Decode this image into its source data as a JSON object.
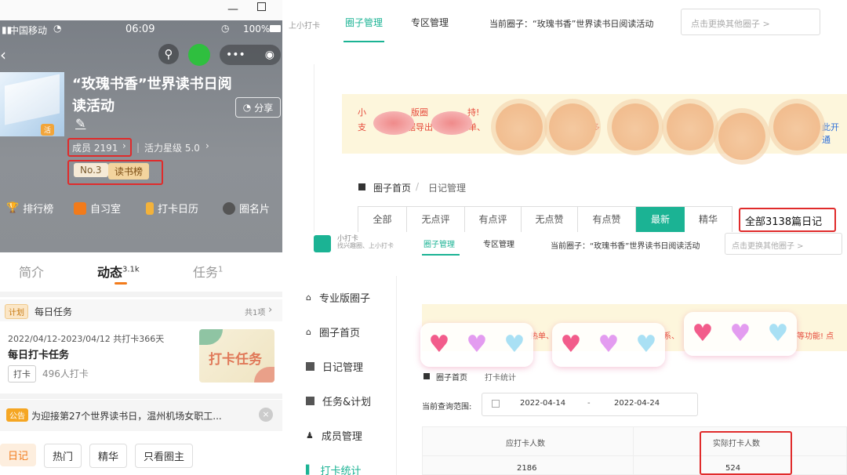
{
  "phone": {
    "status": {
      "carrier": "中国移动",
      "time": "06:09",
      "battery": "100%"
    },
    "circle_title": "“玫瑰书香”世界读书日阅读活动",
    "share_label": "分享",
    "members": "成员 2191",
    "vitality": "活力星级 5.0",
    "rank_no": "No.3",
    "rank_list": "读书榜",
    "badge": "活",
    "quick_links": [
      "排行榜",
      "自习室",
      "打卡日历",
      "圈名片"
    ],
    "tabs": [
      {
        "label": "简介",
        "sup": ""
      },
      {
        "label": "动态",
        "sup": "3.1k"
      },
      {
        "label": "任务",
        "sup": "1"
      }
    ],
    "plan_tag": "计划",
    "daily_task": "每日任务",
    "task_count": "共1项",
    "task_date": "2022/04/12-2023/04/12 共打卡366天",
    "task_name": "每日打卡任务",
    "task_btn": "打卡",
    "task_people": "496人打卡",
    "task_thumb_text": "打卡任务",
    "notice_tag": "公告",
    "notice_text": "为迎接第27个世界读书日，温州机场女职工...",
    "filters": [
      "日记",
      "热门",
      "精华",
      "只看圈主"
    ]
  },
  "top_panel": {
    "side_label": "上小打卡",
    "tabs": [
      "圈子管理",
      "专区管理"
    ],
    "current_circle": "当前圈子：“玫瑰书香”世界读书日阅读活动",
    "switch_placeholder": "点击更换其他圈子 >",
    "banner_fragments": [
      "小",
      "版圈",
      "持!",
      "支",
      "数据导出",
      "表单、",
      "多",
      "此开通"
    ],
    "breadcrumb": [
      "圈子首页",
      "日记管理"
    ],
    "filters": [
      "全部",
      "无点评",
      "有点评",
      "无点赞",
      "有点赞",
      "最新",
      "精华"
    ],
    "total": "全部3138篇日记"
  },
  "bottom_panel": {
    "logo_text": "小打卡",
    "logo_sub": "找兴趣圈、上小打卡",
    "tabs": [
      "圈子管理",
      "专区管理"
    ],
    "current_circle": "当前圈子：“玫瑰书香”世界读书日阅读活动",
    "switch_placeholder": "点击更换其他圈子 >",
    "sidebar": [
      "专业版圈子",
      "圈子首页",
      "日记管理",
      "任务&计划",
      "成员管理",
      "打卡统计"
    ],
    "banner_fragments": [
      "热单、",
      "系、",
      "等功能! 点"
    ],
    "breadcrumb": [
      "圈子首页",
      "打卡统计"
    ],
    "range_label": "当前查询范围:",
    "date_start": "2022-04-14",
    "date_sep": "-",
    "date_end": "2022-04-24",
    "table_headers": [
      "应打卡人数",
      "实际打卡人数"
    ],
    "table_row": [
      "2186",
      "524"
    ]
  },
  "colors": {
    "accent": "#1bb394",
    "highlight": "#e02b2b",
    "orange": "#f27b1b"
  }
}
